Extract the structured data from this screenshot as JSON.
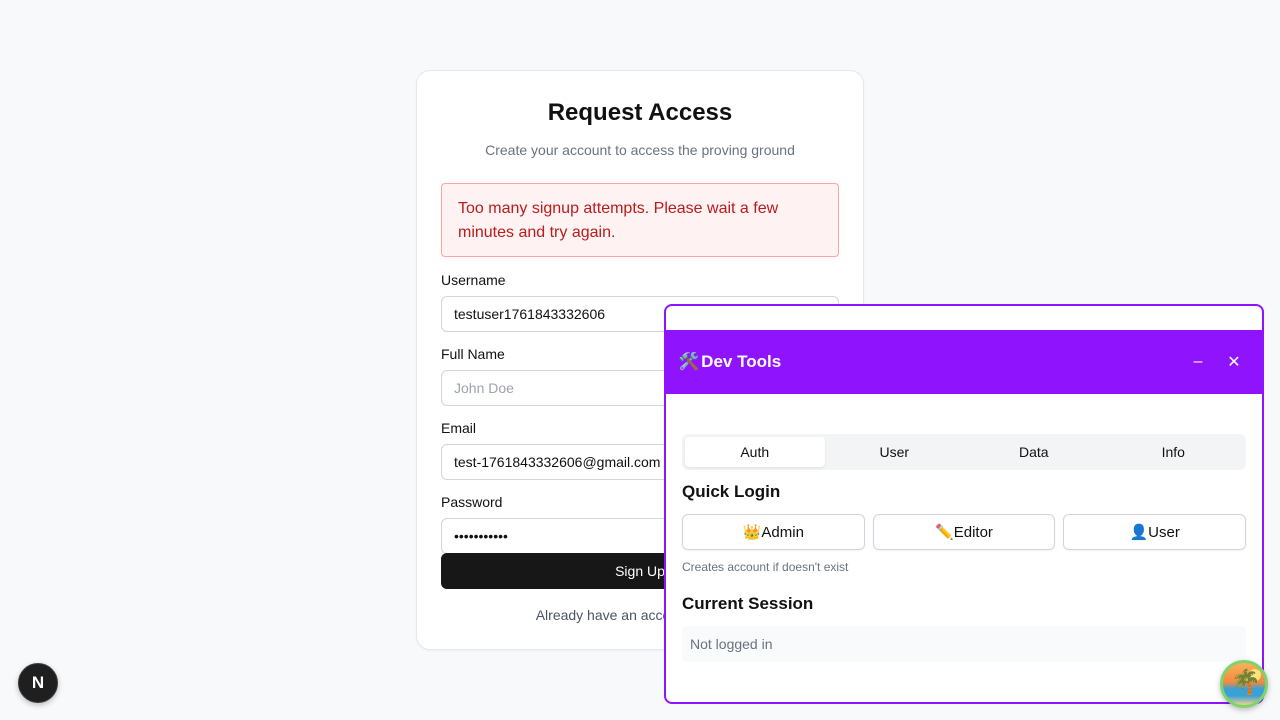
{
  "signup": {
    "title": "Request Access",
    "subtitle": "Create your account to access the proving ground",
    "error": "Too many signup attempts. Please wait a few minutes and try again.",
    "fields": {
      "username": {
        "label": "Username",
        "value": "testuser1761843332606",
        "placeholder": ""
      },
      "full_name": {
        "label": "Full Name",
        "value": "",
        "placeholder": "John Doe"
      },
      "email": {
        "label": "Email",
        "value": "test-1761843332606@gmail.com",
        "placeholder": ""
      },
      "password": {
        "label": "Password",
        "value": "•••••••••••",
        "placeholder": ""
      }
    },
    "submit_label": "Sign Up",
    "footer_text": "Already have an account? Sign in"
  },
  "devtools": {
    "title_icon": "🛠️",
    "title": "Dev Tools",
    "minimize_label": "–",
    "close_label": "✕",
    "tabs": [
      {
        "label": "Auth",
        "active": true
      },
      {
        "label": "User",
        "active": false
      },
      {
        "label": "Data",
        "active": false
      },
      {
        "label": "Info",
        "active": false
      }
    ],
    "quick_login": {
      "title": "Quick Login",
      "buttons": [
        {
          "label": "👑Admin"
        },
        {
          "label": "✏️Editor"
        },
        {
          "label": "👤User"
        }
      ],
      "note": "Creates account if doesn't exist"
    },
    "session": {
      "title": "Current Session",
      "status": "Not logged in"
    },
    "accent_color": "#9013fe"
  },
  "badges": {
    "next_letter": "N",
    "avatar_icon": "palm-tree-sunset-icon"
  }
}
